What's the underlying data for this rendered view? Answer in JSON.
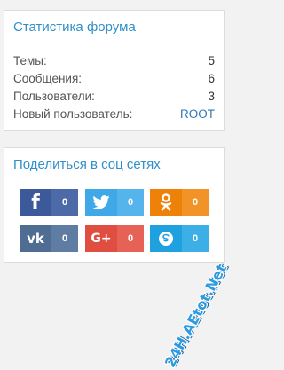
{
  "stats": {
    "title": "Статистика форума",
    "rows": [
      {
        "label": "Темы:",
        "value": "5"
      },
      {
        "label": "Сообщения:",
        "value": "6"
      },
      {
        "label": "Пользователи:",
        "value": "3"
      },
      {
        "label": "Новый пользователь:",
        "value": "ROOT"
      }
    ]
  },
  "share": {
    "title": "Поделиться в соц сетях",
    "buttons": [
      {
        "network": "facebook",
        "icon": "facebook-icon",
        "count": "0",
        "color": "#3c5a99"
      },
      {
        "network": "twitter",
        "icon": "twitter-icon",
        "count": "0",
        "color": "#3fa9e8"
      },
      {
        "network": "odnoklassniki",
        "icon": "odnoklassniki-icon",
        "count": "0",
        "color": "#ee8208"
      },
      {
        "network": "vkontakte",
        "icon": "vk-icon",
        "count": "0",
        "color": "#4f6d93"
      },
      {
        "network": "google-plus",
        "icon": "google-plus-icon",
        "count": "0",
        "color": "#e04d41"
      },
      {
        "network": "skype",
        "icon": "skype-icon",
        "count": "0",
        "color": "#1fa1e0"
      }
    ],
    "glyphs": {
      "facebook": "f",
      "vkontakte": "vk",
      "google_plus": "G+"
    }
  },
  "watermark": {
    "text": "24H.AEtot.Net"
  }
}
